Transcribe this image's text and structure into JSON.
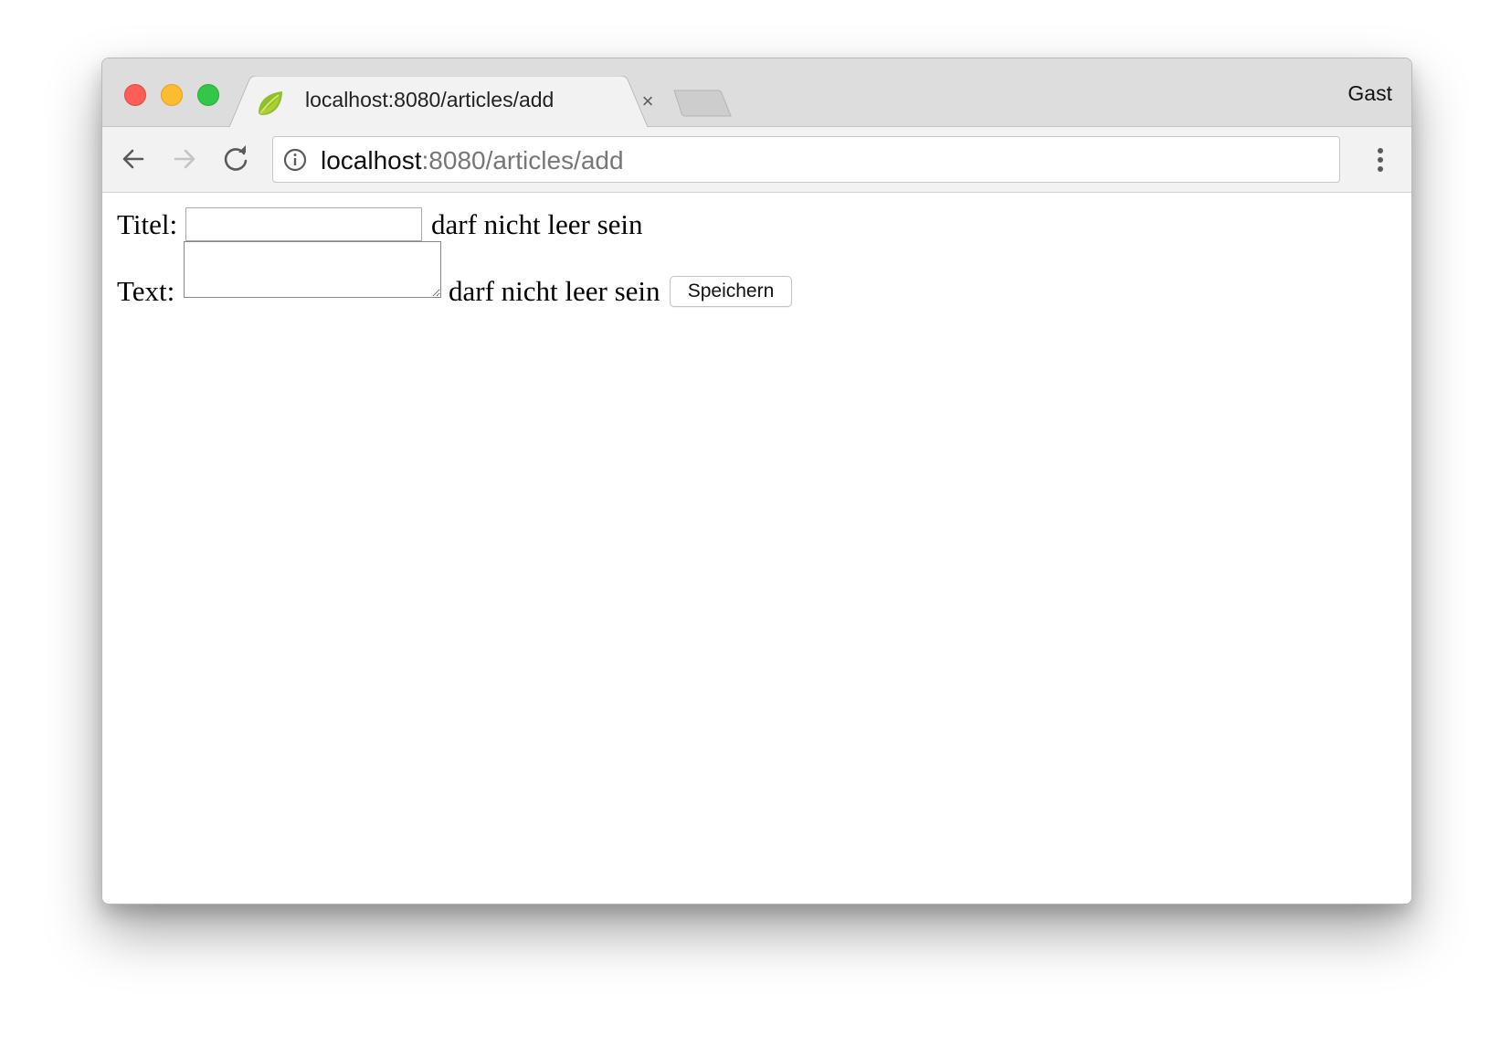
{
  "browser": {
    "tab": {
      "title": "localhost:8080/articles/add",
      "favicon": "spring-leaf-icon",
      "close_glyph": "×"
    },
    "profile_label": "Gast",
    "address_bar": {
      "host": "localhost",
      "rest": ":8080/articles/add"
    },
    "icons": {
      "back": "arrow-left-icon",
      "forward": "arrow-right-icon",
      "reload": "reload-icon",
      "info": "info-icon",
      "menu": "more-vertical-icon"
    },
    "colors": {
      "close": "#fc5e57",
      "minimize": "#fdbc2e",
      "maximize": "#33c748",
      "favicon": "#6db33f"
    }
  },
  "form": {
    "title_label": "Titel:",
    "title_value": "",
    "title_error": "darf nicht leer sein",
    "text_label": "Text:",
    "text_value": "",
    "text_error": "darf nicht leer sein",
    "submit_label": "Speichern"
  }
}
